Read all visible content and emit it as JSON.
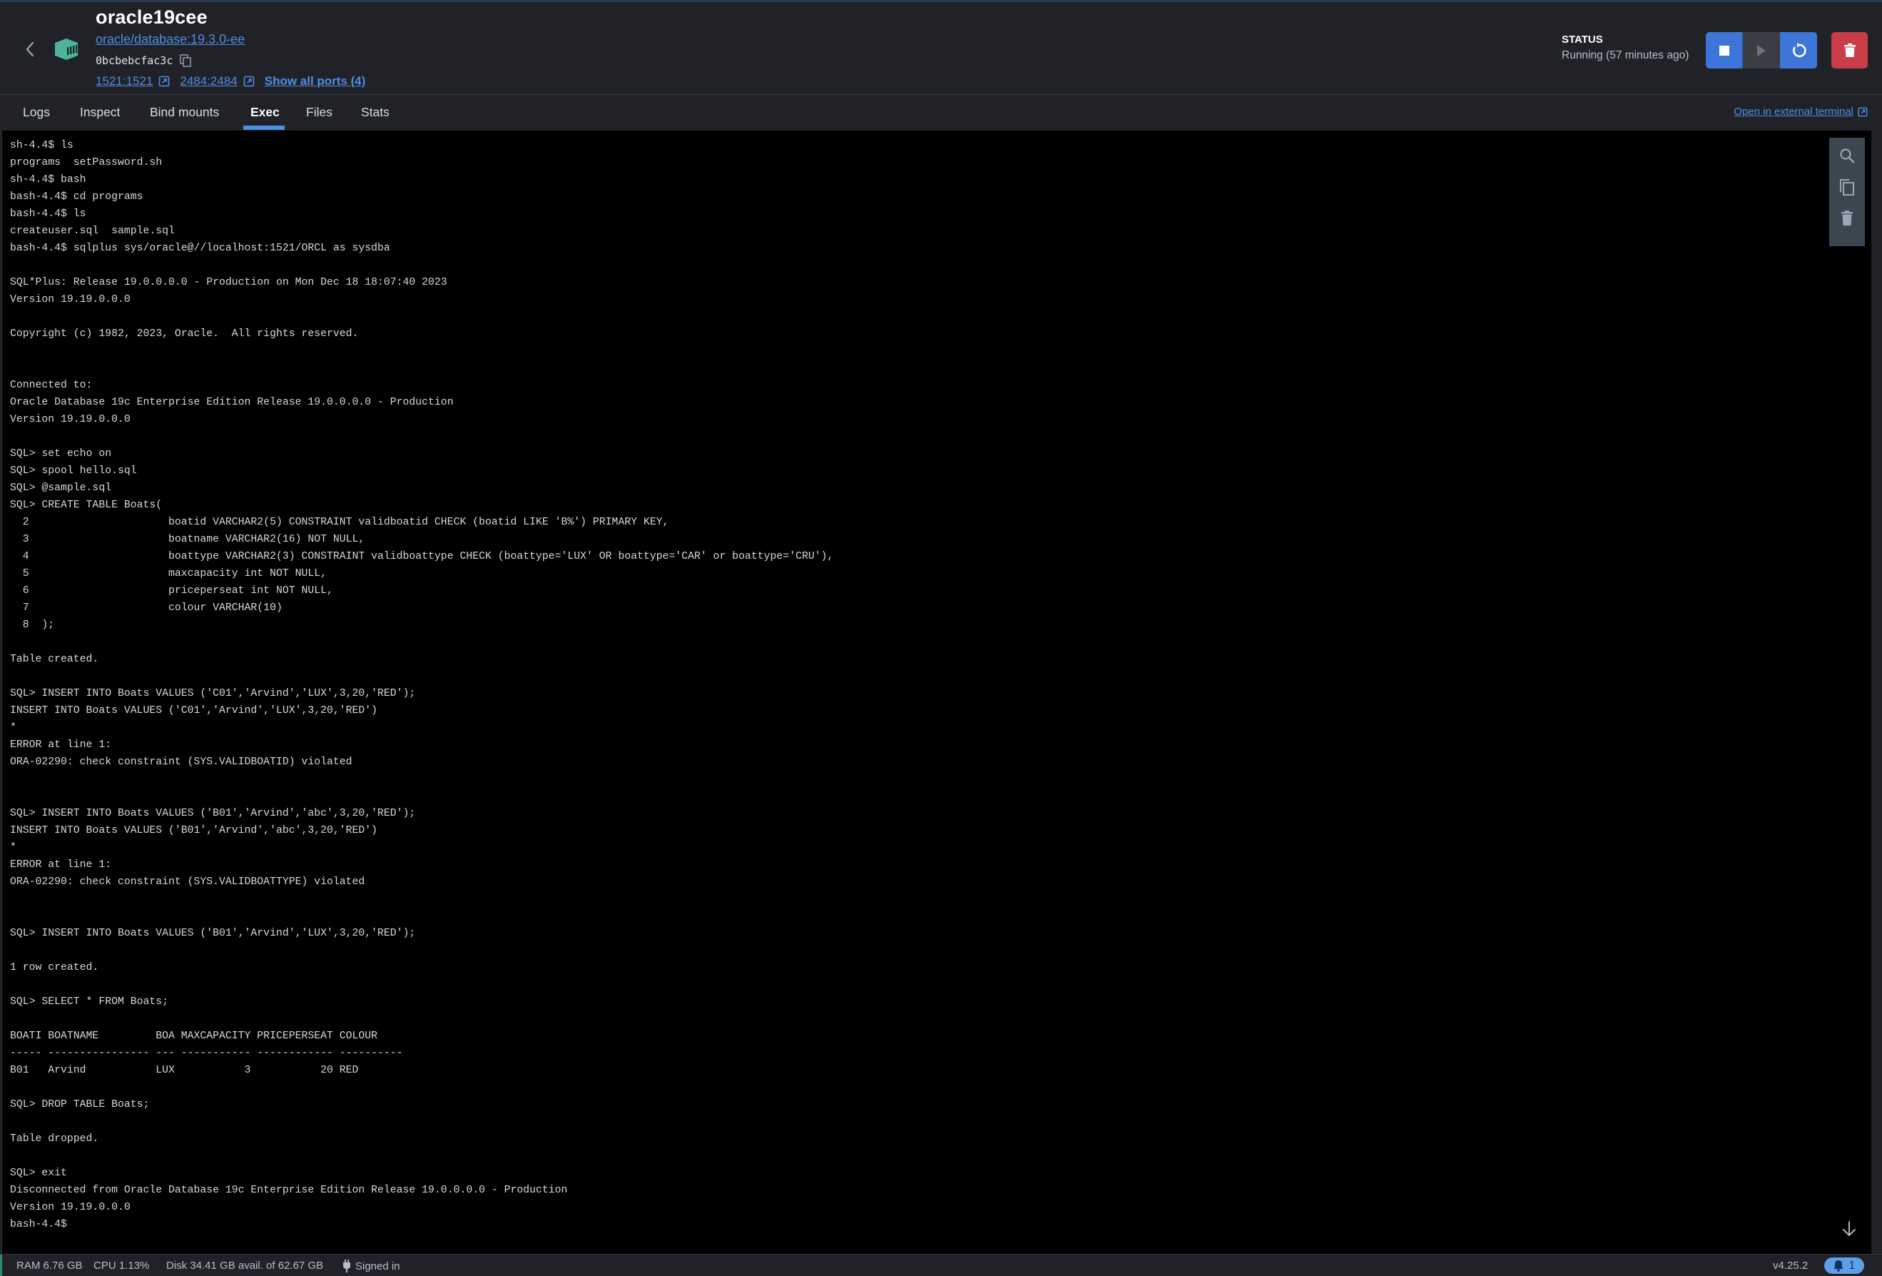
{
  "container": {
    "name": "oracle19cee",
    "image": "oracle/database:19.3.0-ee",
    "id": "0bcbebcfac3c",
    "ports": [
      "1521:1521",
      "2484:2484"
    ],
    "show_all_ports": "Show all ports (4)"
  },
  "status": {
    "label": "STATUS",
    "value": "Running (57 minutes ago)"
  },
  "actions": {
    "stop": "stop-icon",
    "start": "play-icon",
    "restart": "restart-icon",
    "delete": "trash-icon"
  },
  "tabs": [
    {
      "label": "Logs",
      "active": false
    },
    {
      "label": "Inspect",
      "active": false
    },
    {
      "label": "Bind mounts",
      "active": false
    },
    {
      "label": "Exec",
      "active": true
    },
    {
      "label": "Files",
      "active": false
    },
    {
      "label": "Stats",
      "active": false
    }
  ],
  "open_external_terminal": "Open in external terminal",
  "terminal": {
    "lines": [
      "sh-4.4$ ls",
      "programs  setPassword.sh",
      "sh-4.4$ bash",
      "bash-4.4$ cd programs",
      "bash-4.4$ ls",
      "createuser.sql  sample.sql",
      "bash-4.4$ sqlplus sys/oracle@//localhost:1521/ORCL as sysdba",
      "",
      "SQL*Plus: Release 19.0.0.0.0 - Production on Mon Dec 18 18:07:40 2023",
      "Version 19.19.0.0.0",
      "",
      "Copyright (c) 1982, 2023, Oracle.  All rights reserved.",
      "",
      "",
      "Connected to:",
      "Oracle Database 19c Enterprise Edition Release 19.0.0.0.0 - Production",
      "Version 19.19.0.0.0",
      "",
      "SQL> set echo on",
      "SQL> spool hello.sql",
      "SQL> @sample.sql",
      "SQL> CREATE TABLE Boats(",
      "  2                      boatid VARCHAR2(5) CONSTRAINT validboatid CHECK (boatid LIKE 'B%') PRIMARY KEY,",
      "  3                      boatname VARCHAR2(16) NOT NULL,",
      "  4                      boattype VARCHAR2(3) CONSTRAINT validboattype CHECK (boattype='LUX' OR boattype='CAR' or boattype='CRU'),",
      "  5                      maxcapacity int NOT NULL,",
      "  6                      priceperseat int NOT NULL,",
      "  7                      colour VARCHAR(10)",
      "  8  );",
      "",
      "Table created.",
      "",
      "SQL> INSERT INTO Boats VALUES ('C01','Arvind','LUX',3,20,'RED');",
      "INSERT INTO Boats VALUES ('C01','Arvind','LUX',3,20,'RED')",
      "*",
      "ERROR at line 1:",
      "ORA-02290: check constraint (SYS.VALIDBOATID) violated",
      "",
      "",
      "SQL> INSERT INTO Boats VALUES ('B01','Arvind','abc',3,20,'RED');",
      "INSERT INTO Boats VALUES ('B01','Arvind','abc',3,20,'RED')",
      "*",
      "ERROR at line 1:",
      "ORA-02290: check constraint (SYS.VALIDBOATTYPE) violated",
      "",
      "",
      "SQL> INSERT INTO Boats VALUES ('B01','Arvind','LUX',3,20,'RED');",
      "",
      "1 row created.",
      "",
      "SQL> SELECT * FROM Boats;",
      "",
      "BOATI BOATNAME         BOA MAXCAPACITY PRICEPERSEAT COLOUR",
      "----- ---------------- --- ----------- ------------ ----------",
      "B01   Arvind           LUX           3           20 RED",
      "",
      "SQL> DROP TABLE Boats;",
      "",
      "Table dropped.",
      "",
      "SQL> exit",
      "Disconnected from Oracle Database 19c Enterprise Edition Release 19.0.0.0.0 - Production",
      "Version 19.19.0.0.0",
      "bash-4.4$"
    ]
  },
  "statusbar": {
    "ram": "RAM 6.76 GB",
    "cpu": "CPU 1.13%",
    "disk": "Disk 34.41 GB avail. of 62.67 GB",
    "signed_in": "Signed in",
    "version": "v4.25.2",
    "notifications": "1"
  },
  "colors": {
    "accent": "#4f8ee6",
    "primary_button": "#3d75d9",
    "danger_button": "#c93d48",
    "container_icon": "#4fb39a"
  }
}
